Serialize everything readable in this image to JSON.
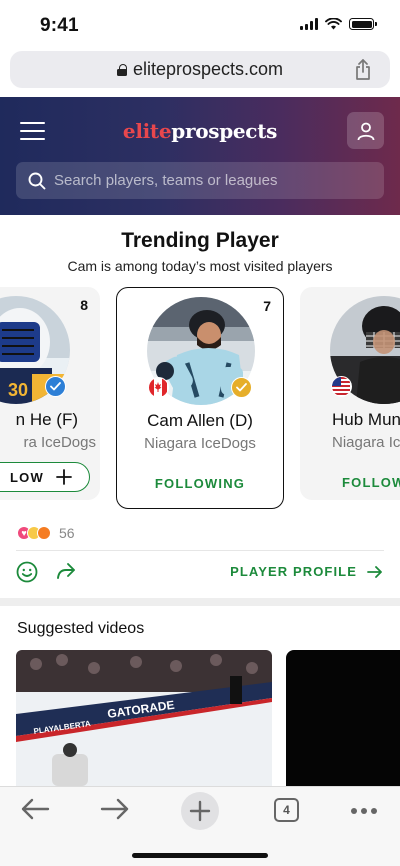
{
  "status_bar": {
    "time": "9:41"
  },
  "browser": {
    "url": "eliteprospects.com",
    "tab_count": "4"
  },
  "header": {
    "logo_part1": "elite",
    "logo_part2": "prospects",
    "search_placeholder": "Search players, teams or leagues"
  },
  "trending": {
    "title": "Trending Player",
    "subtitle": "Cam is among today’s most visited players",
    "cards": [
      {
        "rank": "8",
        "name": "n He (F)",
        "team": "ra IceDogs",
        "action": "LOW",
        "action_state": "follow"
      },
      {
        "rank": "7",
        "name": "Cam Allen (D)",
        "team": "Niagara IceDogs",
        "action": "FOLLOWING",
        "action_state": "following",
        "flag": "canada-flag"
      },
      {
        "rank": "",
        "name": "Hub Mun",
        "team": "Niagara Ice",
        "action": "FOLLOW",
        "action_state": "following",
        "flag": "usa-flag"
      }
    ]
  },
  "social": {
    "reaction_count": "56",
    "profile_link": "PLAYER PROFILE"
  },
  "videos": {
    "title": "Suggested videos"
  },
  "colors": {
    "accent_green": "#1c8a3b",
    "logo_red": "#e8474d",
    "header_gradient_start": "#1f2a5c",
    "header_gradient_end": "#6e2a4c"
  }
}
